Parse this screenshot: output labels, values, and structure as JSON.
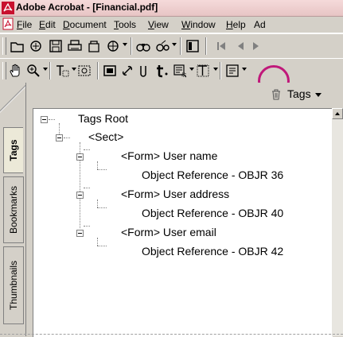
{
  "window": {
    "title": "Adobe Acrobat - [Financial.pdf]"
  },
  "menu": [
    {
      "label": "File",
      "u": "F",
      "rest": "ile"
    },
    {
      "label": "Edit",
      "u": "E",
      "rest": "dit"
    },
    {
      "label": "Document",
      "u": "D",
      "rest": "ocument"
    },
    {
      "label": "Tools",
      "u": "T",
      "rest": "ools"
    },
    {
      "label": "View",
      "u": "V",
      "rest": "iew"
    },
    {
      "label": "Window",
      "u": "W",
      "rest": "indow"
    },
    {
      "label": "Help",
      "u": "H",
      "rest": "elp"
    },
    {
      "label": "Ad",
      "u": "",
      "rest": "Ad"
    }
  ],
  "side_tabs": {
    "tags": "Tags",
    "bookmarks": "Bookmarks",
    "thumbnails": "Thumbnails"
  },
  "panel": {
    "menu_label": "Tags"
  },
  "tree": {
    "root": "Tags Root",
    "sect": "<Sect>",
    "items": [
      {
        "form": "<Form> User name",
        "ref": "Object Reference - OBJR 36"
      },
      {
        "form": "<Form> User address",
        "ref": "Object Reference - OBJR 40"
      },
      {
        "form": "<Form> User email",
        "ref": "Object Reference - OBJR 42"
      }
    ]
  },
  "colors": {
    "highlight": "#c0187a",
    "title_bg": "#e7c4c4",
    "chrome": "#d4d0c8"
  }
}
